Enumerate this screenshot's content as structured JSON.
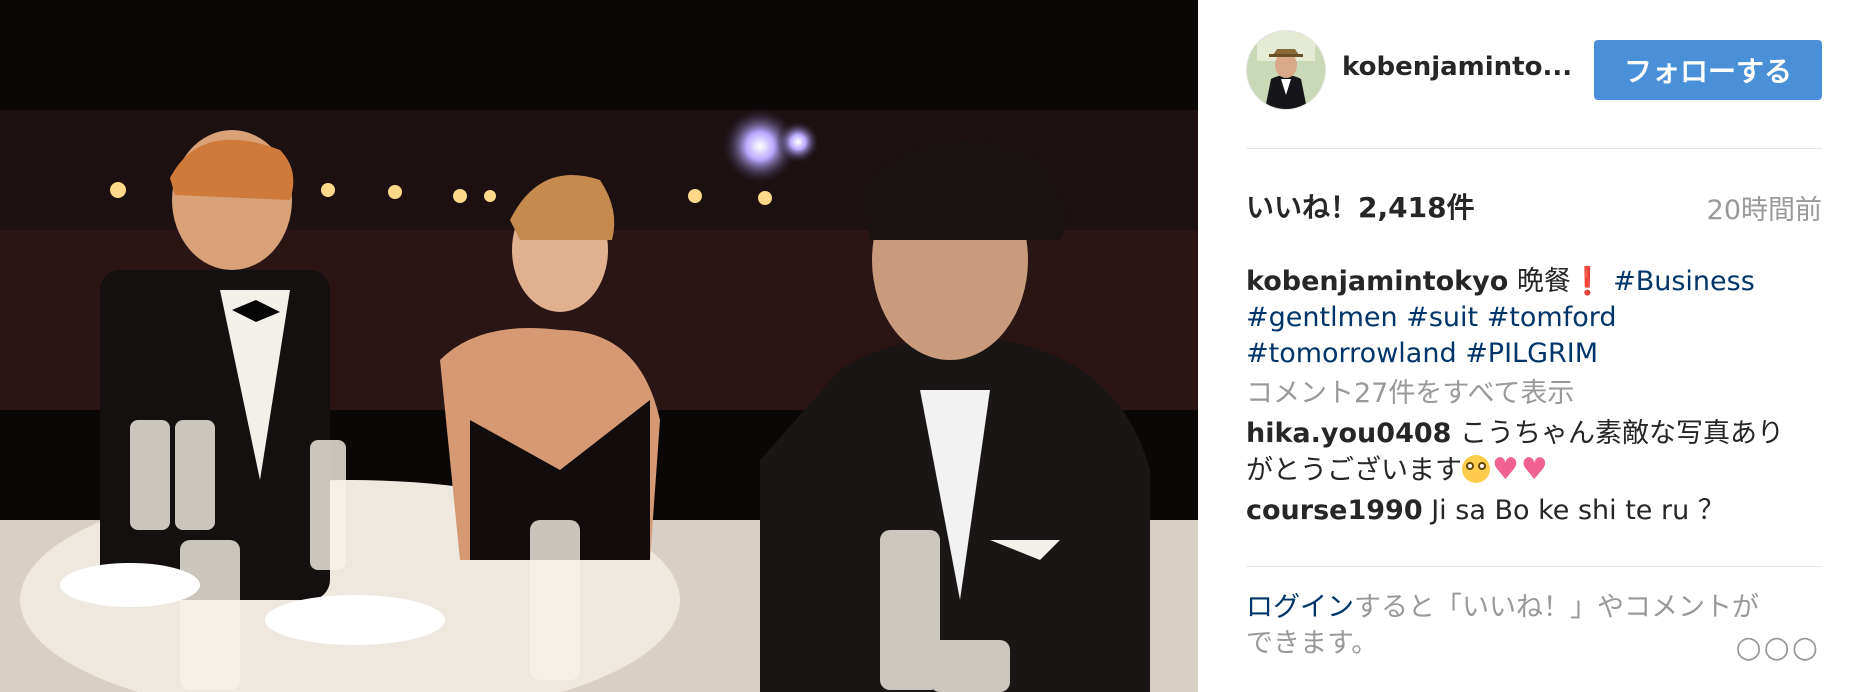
{
  "photo": {
    "alt_icon": "photo"
  },
  "header": {
    "username": "kobenjaminto...",
    "follow_label": "フォローする"
  },
  "meta": {
    "likes": "いいね！2,418件",
    "time": "20時間前"
  },
  "caption": {
    "user": "kobenjamintokyo",
    "text": "晩餐",
    "exclaim": "❗",
    "tags": [
      "#Business",
      "#gentlmen",
      "#suit",
      "#tomford",
      "#tomorrowland",
      "#PILGRIM"
    ]
  },
  "comments": {
    "view_all": "コメント27件をすべて表示",
    "items": [
      {
        "user": "hika.you0408",
        "text": "こうちゃん素敵な写真ありがとうございます"
      },
      {
        "user": "course1990",
        "text": "Ji sa Bo ke shi te ru ？"
      }
    ]
  },
  "login": {
    "link": "ログイン",
    "text": "すると「いいね！」やコメントができます。"
  },
  "icons": {
    "more": "more-icon"
  }
}
